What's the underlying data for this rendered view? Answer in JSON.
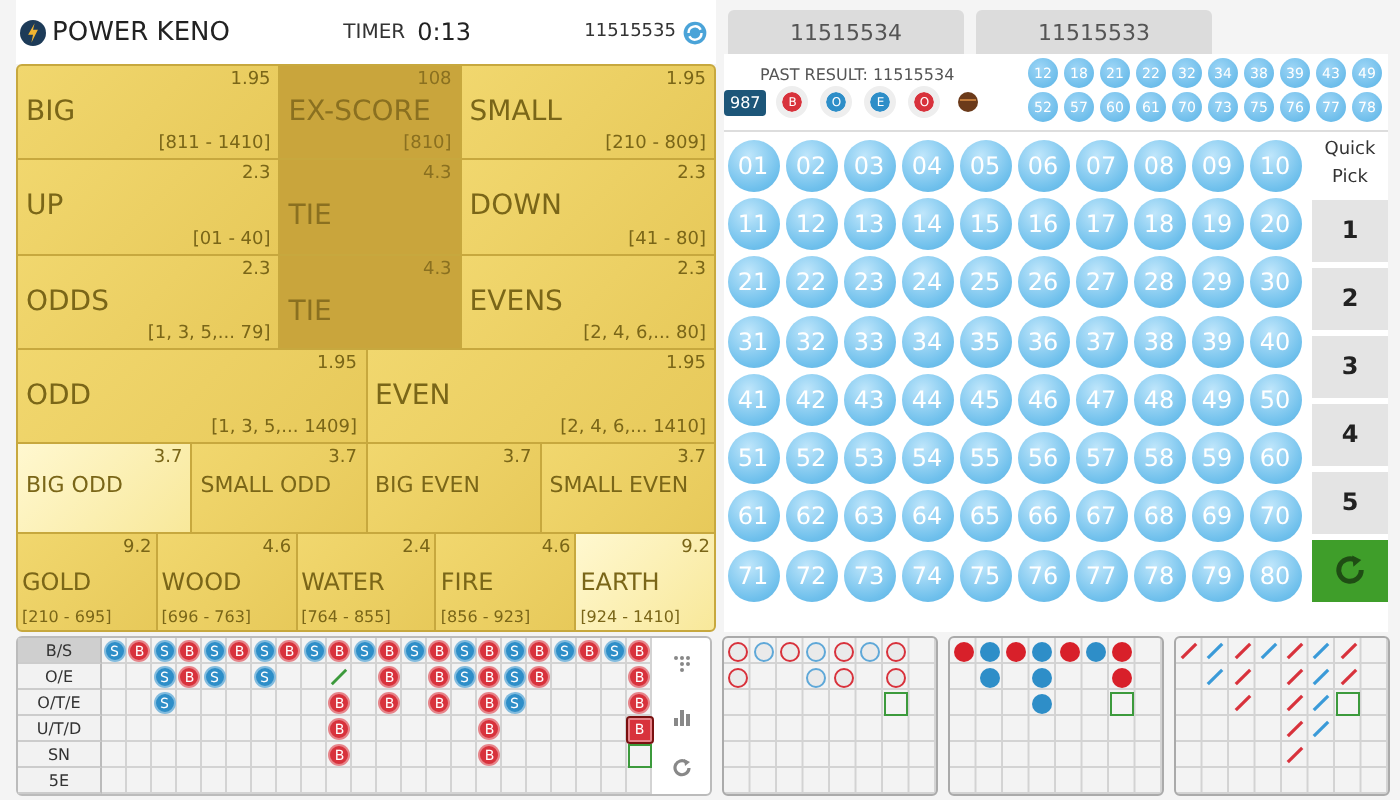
{
  "header": {
    "title": "POWER KENO",
    "timer_label": "TIMER",
    "timer": "0:13",
    "draw": "11515535"
  },
  "tabs": [
    {
      "label": "11515534"
    },
    {
      "label": "11515533"
    }
  ],
  "bets": [
    {
      "cells": [
        {
          "label": "BIG",
          "odds": "1.95",
          "range": "[811 - 1410]",
          "kind": "side",
          "selected": false
        },
        {
          "label": "EX-SCORE",
          "odds": "108",
          "range": "[810]",
          "kind": "center",
          "selected": false
        },
        {
          "label": "SMALL",
          "odds": "1.95",
          "range": "[210 - 809]",
          "kind": "side",
          "selected": false
        }
      ]
    },
    {
      "cells": [
        {
          "label": "UP",
          "odds": "2.3",
          "range": "[01 - 40]",
          "kind": "side",
          "selected": false
        },
        {
          "label": "TIE",
          "odds": "4.3",
          "kind": "center",
          "selected": false
        },
        {
          "label": "DOWN",
          "odds": "2.3",
          "range": "[41 - 80]",
          "kind": "side",
          "selected": false
        }
      ]
    },
    {
      "cells": [
        {
          "label": "ODDS",
          "odds": "2.3",
          "range": "[1, 3, 5,... 79]",
          "kind": "side",
          "selected": false
        },
        {
          "label": "TIE",
          "odds": "4.3",
          "kind": "center",
          "selected": false
        },
        {
          "label": "EVENS",
          "odds": "2.3",
          "range": "[2, 4, 6,... 80]",
          "kind": "side",
          "selected": false
        }
      ]
    },
    {
      "cells": [
        {
          "label": "ODD",
          "odds": "1.95",
          "range": "[1, 3, 5,... 1409]",
          "kind": "side",
          "selected": false
        },
        {
          "label": "EVEN",
          "odds": "1.95",
          "range": "[2, 4, 6,... 1410]",
          "kind": "side",
          "selected": false
        }
      ]
    },
    {
      "cells": [
        {
          "label": "BIG ODD",
          "odds": "3.7",
          "kind": "side",
          "selected": true
        },
        {
          "label": "SMALL ODD",
          "odds": "3.7",
          "kind": "side",
          "selected": false
        },
        {
          "label": "BIG EVEN",
          "odds": "3.7",
          "kind": "side",
          "selected": false
        },
        {
          "label": "SMALL EVEN",
          "odds": "3.7",
          "kind": "side",
          "selected": false
        }
      ]
    },
    {
      "cells": [
        {
          "label": "GOLD",
          "odds": "9.2",
          "range": "[210 - 695]",
          "kind": "side",
          "selected": false
        },
        {
          "label": "WOOD",
          "odds": "4.6",
          "range": "[696 - 763]",
          "kind": "side",
          "selected": false
        },
        {
          "label": "WATER",
          "odds": "2.4",
          "range": "[764 - 855]",
          "kind": "side",
          "selected": false
        },
        {
          "label": "FIRE",
          "odds": "4.6",
          "range": "[856 - 923]",
          "kind": "side",
          "selected": false
        },
        {
          "label": "EARTH",
          "odds": "9.2",
          "range": "[924 - 1410]",
          "kind": "side",
          "selected": true
        }
      ]
    }
  ],
  "past_result": {
    "label": "PAST RESULT: 11515534",
    "sum": "987",
    "markers": [
      {
        "text": "B",
        "color": "#d8323c"
      },
      {
        "text": "O",
        "color": "#2e8ec8"
      },
      {
        "text": "E",
        "color": "#2e8ec8"
      },
      {
        "text": "O",
        "color": "#d8323c"
      }
    ],
    "drawn": [
      "12",
      "18",
      "21",
      "22",
      "32",
      "34",
      "38",
      "39",
      "43",
      "49",
      "52",
      "57",
      "60",
      "61",
      "70",
      "73",
      "75",
      "76",
      "77",
      "78"
    ]
  },
  "board": [
    "01",
    "02",
    "03",
    "04",
    "05",
    "06",
    "07",
    "08",
    "09",
    "10",
    "11",
    "12",
    "13",
    "14",
    "15",
    "16",
    "17",
    "18",
    "19",
    "20",
    "21",
    "22",
    "23",
    "24",
    "25",
    "26",
    "27",
    "28",
    "29",
    "30",
    "31",
    "32",
    "33",
    "34",
    "35",
    "36",
    "37",
    "38",
    "39",
    "40",
    "41",
    "42",
    "43",
    "44",
    "45",
    "46",
    "47",
    "48",
    "49",
    "50",
    "51",
    "52",
    "53",
    "54",
    "55",
    "56",
    "57",
    "58",
    "59",
    "60",
    "61",
    "62",
    "63",
    "64",
    "65",
    "66",
    "67",
    "68",
    "69",
    "70",
    "71",
    "72",
    "73",
    "74",
    "75",
    "76",
    "77",
    "78",
    "79",
    "80"
  ],
  "quick_pick": {
    "label": "Quick Pick",
    "buttons": [
      "1",
      "2",
      "3",
      "4",
      "5"
    ]
  },
  "road": {
    "rows": [
      {
        "label": "B/S",
        "selected": true,
        "cells": [
          {
            "kind": "ball",
            "text": "S",
            "color": "#2e8ec8"
          },
          {
            "kind": "ball",
            "text": "B",
            "color": "#d8323c"
          },
          {
            "kind": "ball",
            "text": "S",
            "color": "#2e8ec8"
          },
          {
            "kind": "ball",
            "text": "B",
            "color": "#d8323c"
          },
          {
            "kind": "ball",
            "text": "S",
            "color": "#2e8ec8"
          },
          {
            "kind": "ball",
            "text": "B",
            "color": "#d8323c"
          },
          {
            "kind": "ball",
            "text": "S",
            "color": "#2e8ec8"
          },
          {
            "kind": "ball",
            "text": "B",
            "color": "#d8323c"
          },
          {
            "kind": "ball",
            "text": "S",
            "color": "#2e8ec8"
          },
          {
            "kind": "ball",
            "text": "B",
            "color": "#d8323c"
          },
          {
            "kind": "ball",
            "text": "S",
            "color": "#2e8ec8"
          },
          {
            "kind": "ball",
            "text": "B",
            "color": "#d8323c"
          },
          {
            "kind": "ball",
            "text": "S",
            "color": "#2e8ec8"
          },
          {
            "kind": "ball",
            "text": "B",
            "color": "#d8323c"
          },
          {
            "kind": "ball",
            "text": "S",
            "color": "#2e8ec8"
          },
          {
            "kind": "ball",
            "text": "B",
            "color": "#d8323c"
          },
          {
            "kind": "ball",
            "text": "S",
            "color": "#2e8ec8"
          },
          {
            "kind": "ball",
            "text": "B",
            "color": "#d8323c"
          },
          {
            "kind": "ball",
            "text": "S",
            "color": "#2e8ec8"
          },
          {
            "kind": "ball",
            "text": "B",
            "color": "#d8323c"
          },
          {
            "kind": "ball",
            "text": "S",
            "color": "#2e8ec8"
          },
          {
            "kind": "ball",
            "text": "B",
            "color": "#d8323c"
          }
        ]
      },
      {
        "label": "O/E",
        "selected": false,
        "cells": [
          null,
          null,
          {
            "kind": "ball",
            "text": "S",
            "color": "#2e8ec8"
          },
          {
            "kind": "ball",
            "text": "B",
            "color": "#d8323c"
          },
          {
            "kind": "ball",
            "text": "S",
            "color": "#2e8ec8"
          },
          null,
          {
            "kind": "ball",
            "text": "S",
            "color": "#2e8ec8"
          },
          null,
          null,
          {
            "kind": "line",
            "color": "#3c9a3c"
          },
          null,
          {
            "kind": "ball",
            "text": "B",
            "color": "#d8323c"
          },
          null,
          {
            "kind": "ball",
            "text": "B",
            "color": "#d8323c"
          },
          {
            "kind": "ball",
            "text": "S",
            "color": "#2e8ec8"
          },
          {
            "kind": "ball",
            "text": "B",
            "color": "#d8323c"
          },
          {
            "kind": "ball",
            "text": "S",
            "color": "#2e8ec8"
          },
          {
            "kind": "ball",
            "text": "B",
            "color": "#d8323c"
          },
          null,
          null,
          null,
          {
            "kind": "ball",
            "text": "B",
            "color": "#d8323c"
          }
        ]
      },
      {
        "label": "O/T/E",
        "selected": false,
        "cells": [
          null,
          null,
          {
            "kind": "ball",
            "text": "S",
            "color": "#2e8ec8"
          },
          null,
          null,
          null,
          null,
          null,
          null,
          {
            "kind": "ball",
            "text": "B",
            "color": "#d8323c"
          },
          null,
          {
            "kind": "ball",
            "text": "B",
            "color": "#d8323c"
          },
          null,
          {
            "kind": "ball",
            "text": "B",
            "color": "#d8323c"
          },
          null,
          {
            "kind": "ball",
            "text": "B",
            "color": "#d8323c"
          },
          {
            "kind": "ball",
            "text": "S",
            "color": "#2e8ec8"
          },
          null,
          null,
          null,
          null,
          {
            "kind": "ball",
            "text": "B",
            "color": "#d8323c"
          }
        ]
      },
      {
        "label": "U/T/D",
        "selected": false,
        "cells": [
          null,
          null,
          null,
          null,
          null,
          null,
          null,
          null,
          null,
          {
            "kind": "ball",
            "text": "B",
            "color": "#d8323c"
          },
          null,
          null,
          null,
          null,
          null,
          {
            "kind": "ball",
            "text": "B",
            "color": "#d8323c"
          },
          null,
          null,
          null,
          null,
          null,
          {
            "kind": "latest",
            "text": "B",
            "color": "#d8323c"
          }
        ]
      },
      {
        "label": "SN",
        "selected": false,
        "cells": [
          null,
          null,
          null,
          null,
          null,
          null,
          null,
          null,
          null,
          {
            "kind": "ball",
            "text": "B",
            "color": "#d8323c"
          },
          null,
          null,
          null,
          null,
          null,
          {
            "kind": "ball",
            "text": "B",
            "color": "#d8323c"
          },
          null,
          null,
          null,
          null,
          null,
          {
            "kind": "next"
          }
        ]
      },
      {
        "label": "5E",
        "selected": false,
        "cells": []
      }
    ]
  },
  "small_roads": [
    {
      "columns": [
        [
          {
            "kind": "ring",
            "color": "#d8323c"
          },
          {
            "kind": "ring",
            "color": "#d8323c"
          }
        ],
        [
          {
            "kind": "ring",
            "color": "#5fa8d8"
          }
        ],
        [
          {
            "kind": "ring",
            "color": "#d8323c"
          }
        ],
        [
          {
            "kind": "ring",
            "color": "#5fa8d8"
          },
          {
            "kind": "ring",
            "color": "#5fa8d8"
          }
        ],
        [
          {
            "kind": "ring",
            "color": "#d8323c"
          },
          {
            "kind": "ring",
            "color": "#d8323c"
          }
        ],
        [
          {
            "kind": "ring",
            "color": "#5fa8d8"
          }
        ],
        [
          {
            "kind": "ring",
            "color": "#d8323c"
          },
          {
            "kind": "ring",
            "color": "#d8323c"
          },
          {
            "kind": "next"
          }
        ]
      ]
    },
    {
      "columns": [
        [
          {
            "kind": "dot",
            "color": "#d8202a"
          }
        ],
        [
          {
            "kind": "dot",
            "color": "#2e8ec8"
          },
          {
            "kind": "dot",
            "color": "#2e8ec8"
          }
        ],
        [
          {
            "kind": "dot",
            "color": "#d8202a"
          }
        ],
        [
          {
            "kind": "dot",
            "color": "#2e8ec8"
          },
          {
            "kind": "dot",
            "color": "#2e8ec8"
          },
          {
            "kind": "dot",
            "color": "#2e8ec8"
          }
        ],
        [
          {
            "kind": "dot",
            "color": "#d8202a"
          }
        ],
        [
          {
            "kind": "dot",
            "color": "#2e8ec8"
          }
        ],
        [
          {
            "kind": "dot",
            "color": "#d8202a"
          },
          {
            "kind": "dot",
            "color": "#d8202a"
          },
          {
            "kind": "next"
          }
        ]
      ]
    },
    {
      "columns": [
        [
          {
            "kind": "slash",
            "color": "#d8323c"
          }
        ],
        [
          {
            "kind": "slash",
            "color": "#3a9ad8"
          },
          {
            "kind": "slash",
            "color": "#3a9ad8"
          }
        ],
        [
          {
            "kind": "slash",
            "color": "#d8323c"
          },
          {
            "kind": "slash",
            "color": "#d8323c"
          },
          {
            "kind": "slash",
            "color": "#d8323c"
          }
        ],
        [
          {
            "kind": "slash",
            "color": "#3a9ad8"
          }
        ],
        [
          {
            "kind": "slash",
            "color": "#d8323c"
          },
          {
            "kind": "slash",
            "color": "#d8323c"
          },
          {
            "kind": "slash",
            "color": "#d8323c"
          },
          {
            "kind": "slash",
            "color": "#d8323c"
          },
          {
            "kind": "slash",
            "color": "#d8323c"
          }
        ],
        [
          {
            "kind": "slash",
            "color": "#3a9ad8"
          },
          {
            "kind": "slash",
            "color": "#3a9ad8"
          },
          {
            "kind": "slash",
            "color": "#3a9ad8"
          },
          {
            "kind": "slash",
            "color": "#3a9ad8"
          }
        ],
        [
          {
            "kind": "slash",
            "color": "#d8323c"
          },
          {
            "kind": "slash",
            "color": "#d8323c"
          },
          {
            "kind": "next"
          }
        ]
      ]
    }
  ]
}
